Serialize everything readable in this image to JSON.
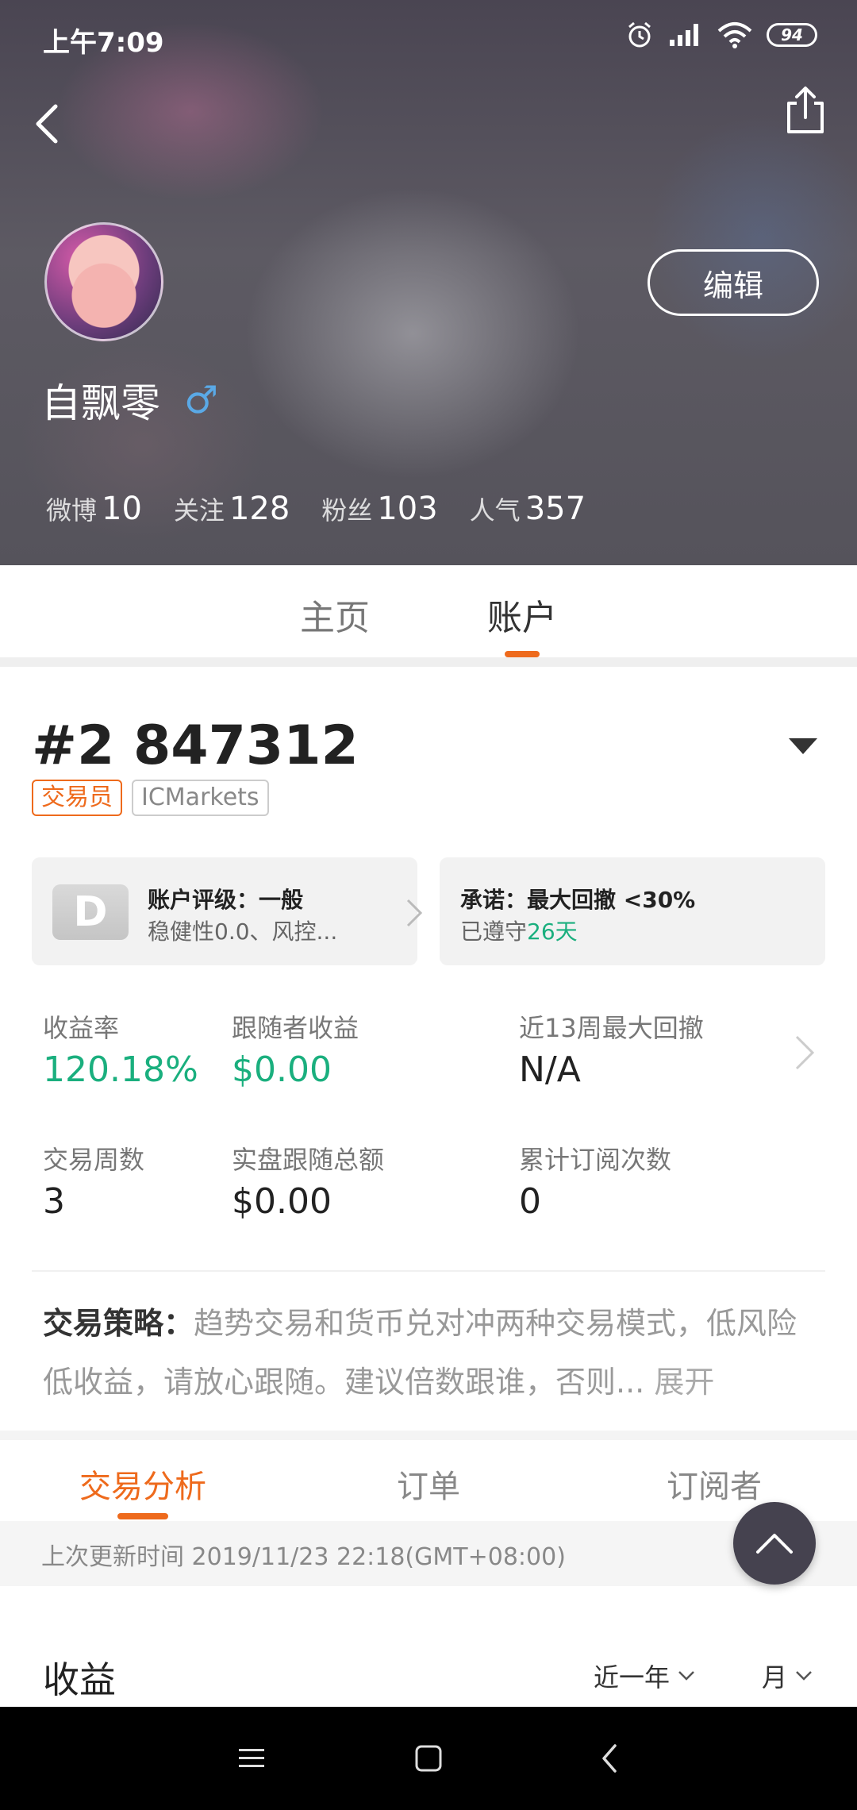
{
  "status_bar": {
    "time": "上午7:09",
    "battery": "94"
  },
  "profile": {
    "username": "自飘零",
    "gender_symbol": "♂",
    "edit_label": "编辑",
    "stats": [
      {
        "label": "微博",
        "value": "10"
      },
      {
        "label": "关注",
        "value": "128"
      },
      {
        "label": "粉丝",
        "value": "103"
      },
      {
        "label": "人气",
        "value": "357"
      }
    ]
  },
  "profile_tabs": {
    "home": "主页",
    "account": "账户",
    "active": "账户"
  },
  "account": {
    "id": "#2 847312",
    "tags": [
      "交易员",
      "ICMarkets"
    ],
    "rating_card": {
      "grade": "D",
      "title": "账户评级：一般",
      "subtitle": "稳健性0.0、风控..."
    },
    "promise_card": {
      "title": "承诺：最大回撤 <30%",
      "kept_prefix": "已遵守",
      "kept_days": "26天"
    },
    "metrics": {
      "return_label": "收益率",
      "return_value": "120.18%",
      "follower_profit_label": "跟随者收益",
      "follower_profit_value": "$0.00",
      "max_drawdown_label": "近13周最大回撤",
      "max_drawdown_value": "N/A",
      "weeks_label": "交易周数",
      "weeks_value": "3",
      "follow_total_label": "实盘跟随总额",
      "follow_total_value": "$0.00",
      "subs_count_label": "累计订阅次数",
      "subs_count_value": "0"
    },
    "strategy": {
      "label": "交易策略：",
      "text": "趋势交易和货币兑对冲两种交易模式，低风险低收益，请放心跟随。建议倍数跟谁，否则...",
      "expand": "展开"
    }
  },
  "analysis_tabs": {
    "analysis": "交易分析",
    "orders": "订单",
    "subscribers": "订阅者",
    "active": "交易分析"
  },
  "update": {
    "text": "上次更新时间 2019/11/23 22:18(GMT+08:00)"
  },
  "income": {
    "title": "收益",
    "range": "近一年",
    "period": "月"
  },
  "colors": {
    "accent_orange": "#ee6a1c",
    "positive_green": "#1aaf7e"
  }
}
